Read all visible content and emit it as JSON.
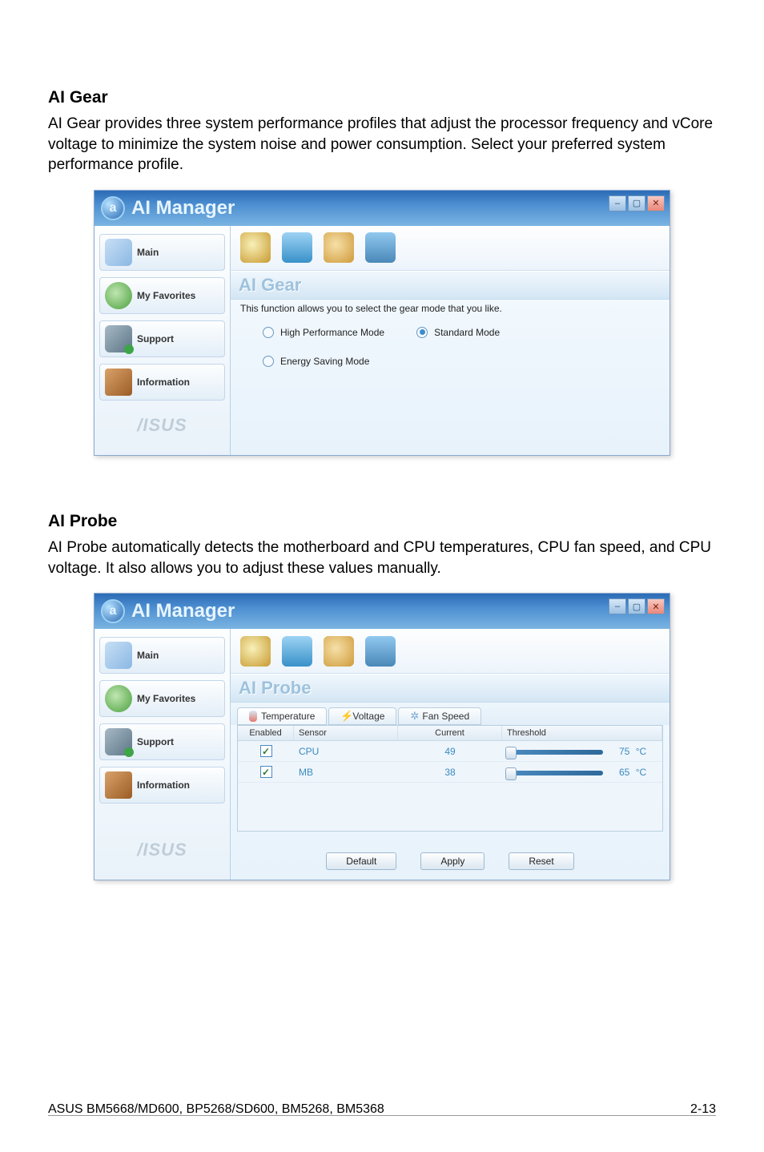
{
  "page": {
    "footer_left": "ASUS BM5668/MD600, BP5268/SD600, BM5268, BM5368",
    "footer_right": "2-13"
  },
  "section_gear": {
    "title": "AI Gear",
    "desc": "AI Gear provides three system performance profiles that adjust the processor frequency and vCore voltage to minimize the system noise and power consumption. Select your preferred system performance profile."
  },
  "section_probe": {
    "title": "AI Probe",
    "desc": "AI Probe automatically detects the motherboard and CPU temperatures, CPU fan speed, and CPU voltage. It also allows you to adjust these values manually."
  },
  "app": {
    "title": "AI Manager",
    "sidebar": {
      "main": "Main",
      "favorites": "My Favorites",
      "support": "Support",
      "information": "Information",
      "brand": "/ISUS"
    }
  },
  "gear_panel": {
    "title": "AI Gear",
    "desc": "This function allows you to select the gear mode that you like.",
    "options": {
      "high": "High Performance Mode",
      "standard": "Standard Mode",
      "energy": "Energy Saving Mode"
    },
    "selected": "standard"
  },
  "probe_panel": {
    "title": "AI Probe",
    "tabs": {
      "temperature": "Temperature",
      "voltage": "Voltage",
      "fanspeed": "Fan Speed"
    },
    "columns": {
      "enabled": "Enabled",
      "sensor": "Sensor",
      "current": "Current",
      "threshold": "Threshold"
    },
    "rows": [
      {
        "enabled": true,
        "sensor": "CPU",
        "current": "49",
        "threshold": "75",
        "unit": "°C"
      },
      {
        "enabled": true,
        "sensor": "MB",
        "current": "38",
        "threshold": "65",
        "unit": "°C"
      }
    ],
    "buttons": {
      "default": "Default",
      "apply": "Apply",
      "reset": "Reset"
    }
  }
}
